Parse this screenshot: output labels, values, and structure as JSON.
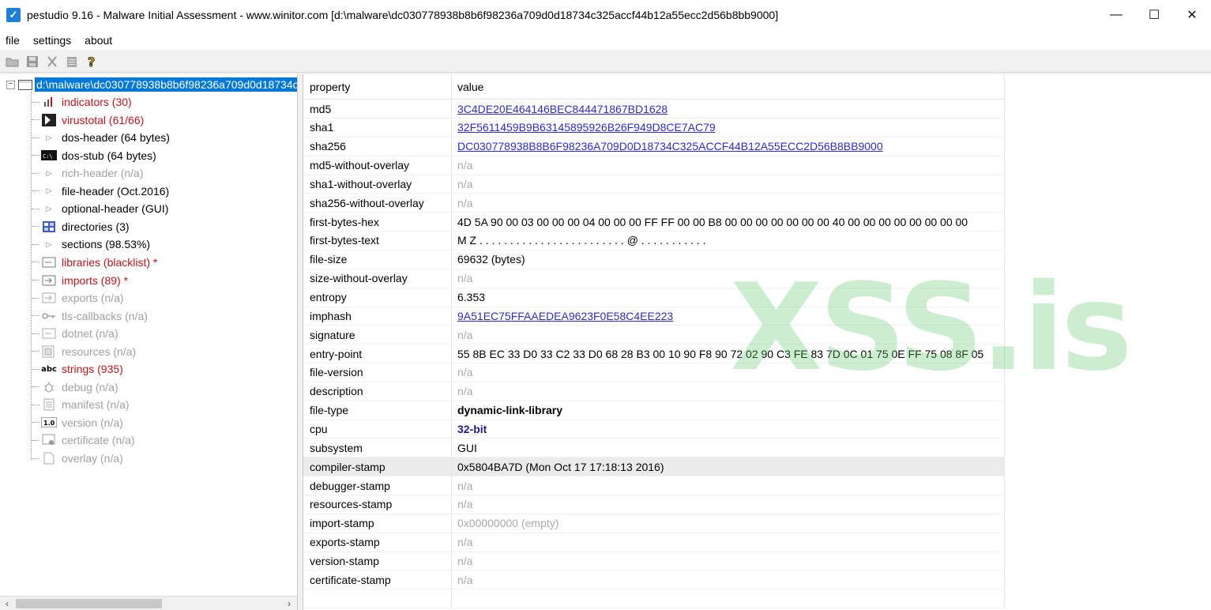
{
  "window": {
    "title": "pestudio 9.16 - Malware Initial Assessment - www.winitor.com [d:\\malware\\dc030778938b8b6f98236a709d0d18734c325accf44b12a55ecc2d56b8bb9000]",
    "minimize": "—",
    "maximize": "☐",
    "close": "✕"
  },
  "menu": {
    "items": [
      "file",
      "settings",
      "about"
    ]
  },
  "toolbar": {
    "icons": [
      "open-icon",
      "save-icon",
      "cut-icon",
      "clipboard-icon",
      "help-icon"
    ]
  },
  "tree": {
    "root_label": "d:\\malware\\dc030778938b8b6f98236a709d0d18734c325accf44b12a55ecc2d56b8bb9000",
    "items": [
      {
        "label": "indicators (30)",
        "icon": "bars-icon",
        "color": "red"
      },
      {
        "label": "virustotal (61/66)",
        "icon": "virustotal-icon",
        "color": "red"
      },
      {
        "label": "dos-header (64 bytes)",
        "icon": "expand-triangle-icon",
        "color": "black"
      },
      {
        "label": "dos-stub (64 bytes)",
        "icon": "console-icon",
        "color": "black"
      },
      {
        "label": "rich-header (n/a)",
        "icon": "expand-triangle-icon",
        "color": "gray"
      },
      {
        "label": "file-header (Oct.2016)",
        "icon": "expand-triangle-icon",
        "color": "black"
      },
      {
        "label": "optional-header (GUI)",
        "icon": "expand-triangle-icon",
        "color": "black"
      },
      {
        "label": "directories (3)",
        "icon": "grid-icon",
        "color": "black"
      },
      {
        "label": "sections (98.53%)",
        "icon": "expand-triangle-icon",
        "color": "black"
      },
      {
        "label": "libraries (blacklist) *",
        "icon": "library-icon",
        "color": "red"
      },
      {
        "label": "imports (89) *",
        "icon": "import-icon",
        "color": "red"
      },
      {
        "label": "exports (n/a)",
        "icon": "export-icon",
        "color": "gray"
      },
      {
        "label": "tls-callbacks (n/a)",
        "icon": "key-icon",
        "color": "gray"
      },
      {
        "label": "dotnet (n/a)",
        "icon": "dotnet-icon",
        "color": "gray"
      },
      {
        "label": "resources (n/a)",
        "icon": "resources-icon",
        "color": "gray"
      },
      {
        "label": "strings (935)",
        "icon": "abc-icon",
        "color": "red"
      },
      {
        "label": "debug (n/a)",
        "icon": "bug-icon",
        "color": "gray"
      },
      {
        "label": "manifest (n/a)",
        "icon": "manifest-icon",
        "color": "gray"
      },
      {
        "label": "version (n/a)",
        "icon": "version-icon",
        "color": "gray"
      },
      {
        "label": "certificate (n/a)",
        "icon": "certificate-icon",
        "color": "gray"
      },
      {
        "label": "overlay (n/a)",
        "icon": "document-icon",
        "color": "gray"
      }
    ]
  },
  "grid": {
    "headers": [
      "property",
      "value"
    ],
    "rows": [
      {
        "property": "md5",
        "value": "3C4DE20E464146BEC844471867BD1628",
        "style": "link"
      },
      {
        "property": "sha1",
        "value": "32F5611459B9B63145895926B26F949D8CE7AC79",
        "style": "link"
      },
      {
        "property": "sha256",
        "value": "DC030778938B8B6F98236A709D0D18734C325ACCF44B12A55ECC2D56B8BB9000",
        "style": "link"
      },
      {
        "property": "md5-without-overlay",
        "value": "n/a",
        "style": "gray"
      },
      {
        "property": "sha1-without-overlay",
        "value": "n/a",
        "style": "gray"
      },
      {
        "property": "sha256-without-overlay",
        "value": "n/a",
        "style": "gray"
      },
      {
        "property": "first-bytes-hex",
        "value": "4D 5A 90 00 03 00 00 00 04 00 00 00 FF FF 00 00 B8 00 00 00 00 00 00 00 40 00 00 00 00 00 00 00 00",
        "style": "black"
      },
      {
        "property": "first-bytes-text",
        "value": "M Z . . . . . . . . . . . . . . . . . . . . . . . . @ . . . . . . . . . . .",
        "style": "black"
      },
      {
        "property": "file-size",
        "value": "69632 (bytes)",
        "style": "black"
      },
      {
        "property": "size-without-overlay",
        "value": "n/a",
        "style": "gray"
      },
      {
        "property": "entropy",
        "value": "6.353",
        "style": "black"
      },
      {
        "property": "imphash",
        "value": "9A51EC75FFAAEDEA9623F0E58C4EE223",
        "style": "link"
      },
      {
        "property": "signature",
        "value": "n/a",
        "style": "gray"
      },
      {
        "property": "entry-point",
        "value": "55 8B EC 33 D0 33 C2 33 D0 68 28 B3 00 10 90 F8 90 72 02 90 C3 FE 83 7D 0C 01 75 0E FF 75 08 8F 05",
        "style": "black"
      },
      {
        "property": "file-version",
        "value": "n/a",
        "style": "gray"
      },
      {
        "property": "description",
        "value": "n/a",
        "style": "gray"
      },
      {
        "property": "file-type",
        "value": "dynamic-link-library",
        "style": "bold"
      },
      {
        "property": "cpu",
        "value": "32-bit",
        "style": "blue-bold"
      },
      {
        "property": "subsystem",
        "value": "GUI",
        "style": "black"
      },
      {
        "property": "compiler-stamp",
        "value": "0x5804BA7D (Mon Oct 17 17:18:13 2016)",
        "style": "black",
        "highlight": true
      },
      {
        "property": "debugger-stamp",
        "value": "n/a",
        "style": "gray"
      },
      {
        "property": "resources-stamp",
        "value": "n/a",
        "style": "gray"
      },
      {
        "property": "import-stamp",
        "value": "0x00000000 (empty)",
        "style": "gray"
      },
      {
        "property": "exports-stamp",
        "value": "n/a",
        "style": "gray"
      },
      {
        "property": "version-stamp",
        "value": "n/a",
        "style": "gray"
      },
      {
        "property": "certificate-stamp",
        "value": "n/a",
        "style": "gray"
      }
    ]
  },
  "watermark": "XSS.is",
  "colors": {
    "selection": "#0078d7",
    "red": "#c0151a",
    "link": "#2b2bd6",
    "gray": "#a8a8a8",
    "watermark": "#64c86e"
  }
}
